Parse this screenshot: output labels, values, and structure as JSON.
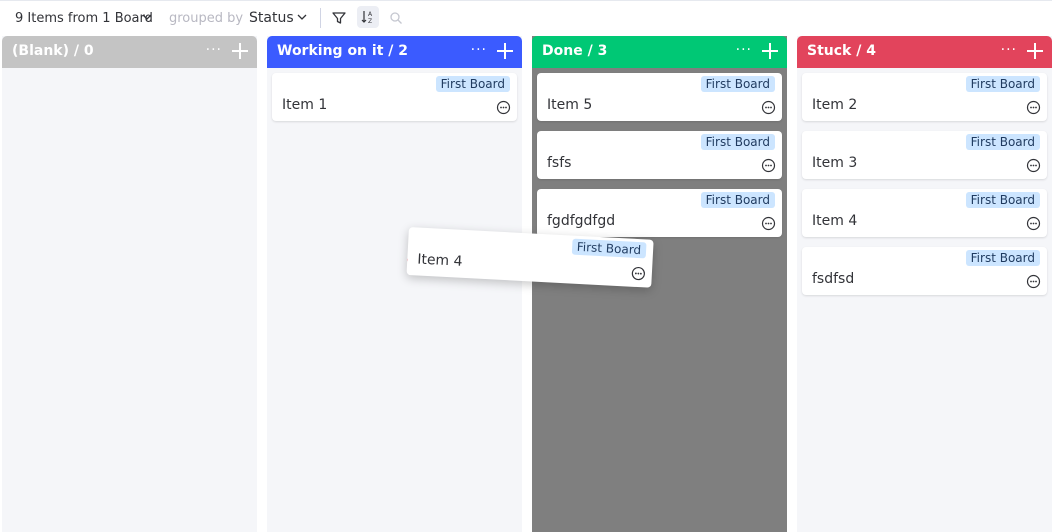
{
  "toolbar": {
    "summary": "9 Items from 1 Board",
    "grouped_by_label": "grouped by",
    "group_value": "Status",
    "icons": [
      "chevron-down-icon",
      "filter-icon",
      "sort-icon",
      "search-icon"
    ]
  },
  "columns": [
    {
      "title": "(Blank) / 0",
      "color": "#c4c4c4",
      "bg": "#f5f6f9",
      "more": "···",
      "cards": []
    },
    {
      "title": "Working on it / 2",
      "color": "#3b5bff",
      "bg": "#f5f6f9",
      "more": "···",
      "cards": [
        {
          "name": "Item 1",
          "board": "First Board"
        }
      ]
    },
    {
      "title": "Done / 3",
      "color": "#00c875",
      "bg": "#7f7f7f",
      "more": "···",
      "cards": [
        {
          "name": "Item 5",
          "board": "First Board"
        },
        {
          "name": "fsfs",
          "board": "First Board"
        },
        {
          "name": "fgdfgdfgd",
          "board": "First Board"
        }
      ]
    },
    {
      "title": "Stuck / 4",
      "color": "#e2445c",
      "bg": "#f5f6f9",
      "more": "···",
      "cards": [
        {
          "name": "Item 2",
          "board": "First Board"
        },
        {
          "name": "Item 3",
          "board": "First Board"
        },
        {
          "name": "Item 4",
          "board": "First Board"
        },
        {
          "name": "fsdfsd",
          "board": "First Board"
        }
      ]
    }
  ],
  "dragging_card": {
    "name": "Item 4",
    "board": "First Board"
  }
}
